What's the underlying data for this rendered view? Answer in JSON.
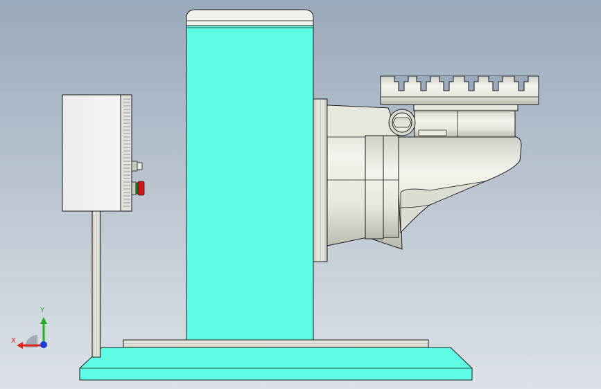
{
  "viewport": {
    "background_top": "#9aa9bb",
    "background_bottom": "#dde2e8"
  },
  "model": {
    "column_color": "#5ffde5",
    "base_color": "#5ffde5",
    "metal_color": "#e8e9e0",
    "edge_color": "#1a1a1a"
  },
  "triad": {
    "x_label": "X",
    "y_label": "Y",
    "x_color": "#e0201c",
    "y_color": "#22b022",
    "z_color": "#1f3cd8"
  },
  "control_box": {
    "stop_button_color": "#d01818",
    "indicator_color": "#1c8a2a"
  }
}
